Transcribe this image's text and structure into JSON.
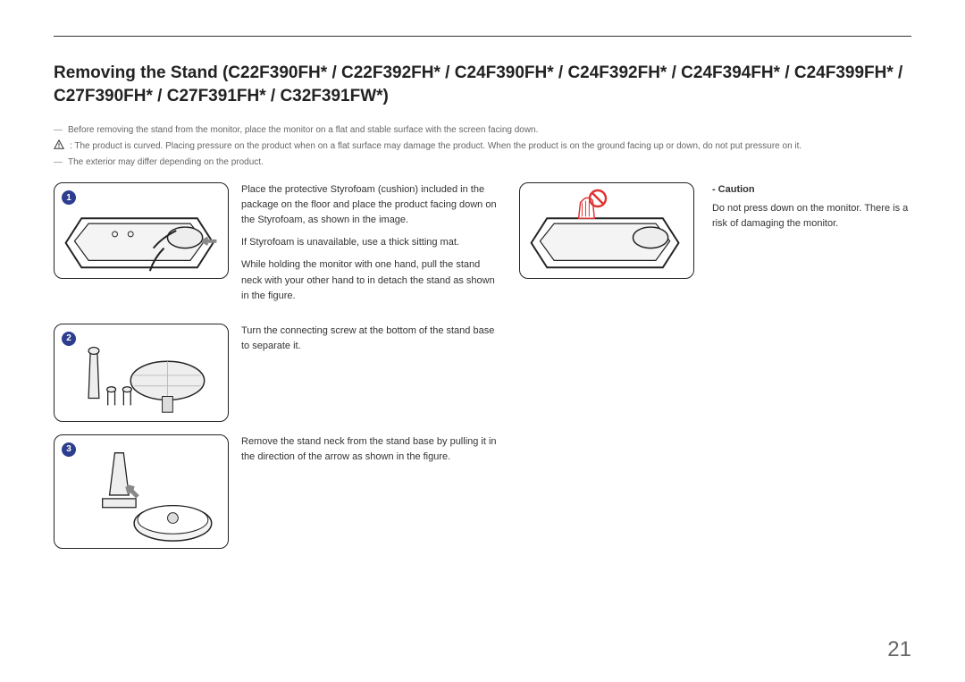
{
  "title": "Removing the Stand (C22F390FH* / C22F392FH* / C24F390FH* / C24F392FH* / C24F394FH* / C24F399FH* / C27F390FH* / C27F391FH* / C32F391FW*)",
  "notes": {
    "n1": "Before removing the stand from the monitor, place the monitor on a flat and stable surface with the screen facing down.",
    "n2": ": The product is curved. Placing pressure on the product when on a flat surface may damage the product. When the product is on the ground facing up or down, do not put pressure on it.",
    "n3": "The exterior may differ depending on the product."
  },
  "steps": {
    "s1": {
      "num": "1",
      "p1": "Place the protective Styrofoam (cushion) included in the package on the floor and place the product facing down on the Styrofoam, as shown in the image.",
      "p2": "If Styrofoam is unavailable, use a thick sitting mat.",
      "p3": "While holding the monitor with one hand, pull the stand neck with your other hand to in detach the stand as shown in the figure."
    },
    "s2": {
      "num": "2",
      "p1": "Turn the connecting screw at the bottom of the stand base to separate it."
    },
    "s3": {
      "num": "3",
      "p1": "Remove the stand neck from the stand base by pulling it in the direction of the arrow as shown in the figure."
    }
  },
  "caution": {
    "title": "- Caution",
    "body": "Do not press down on the monitor. There is a risk of damaging the monitor."
  },
  "pageNumber": "21"
}
